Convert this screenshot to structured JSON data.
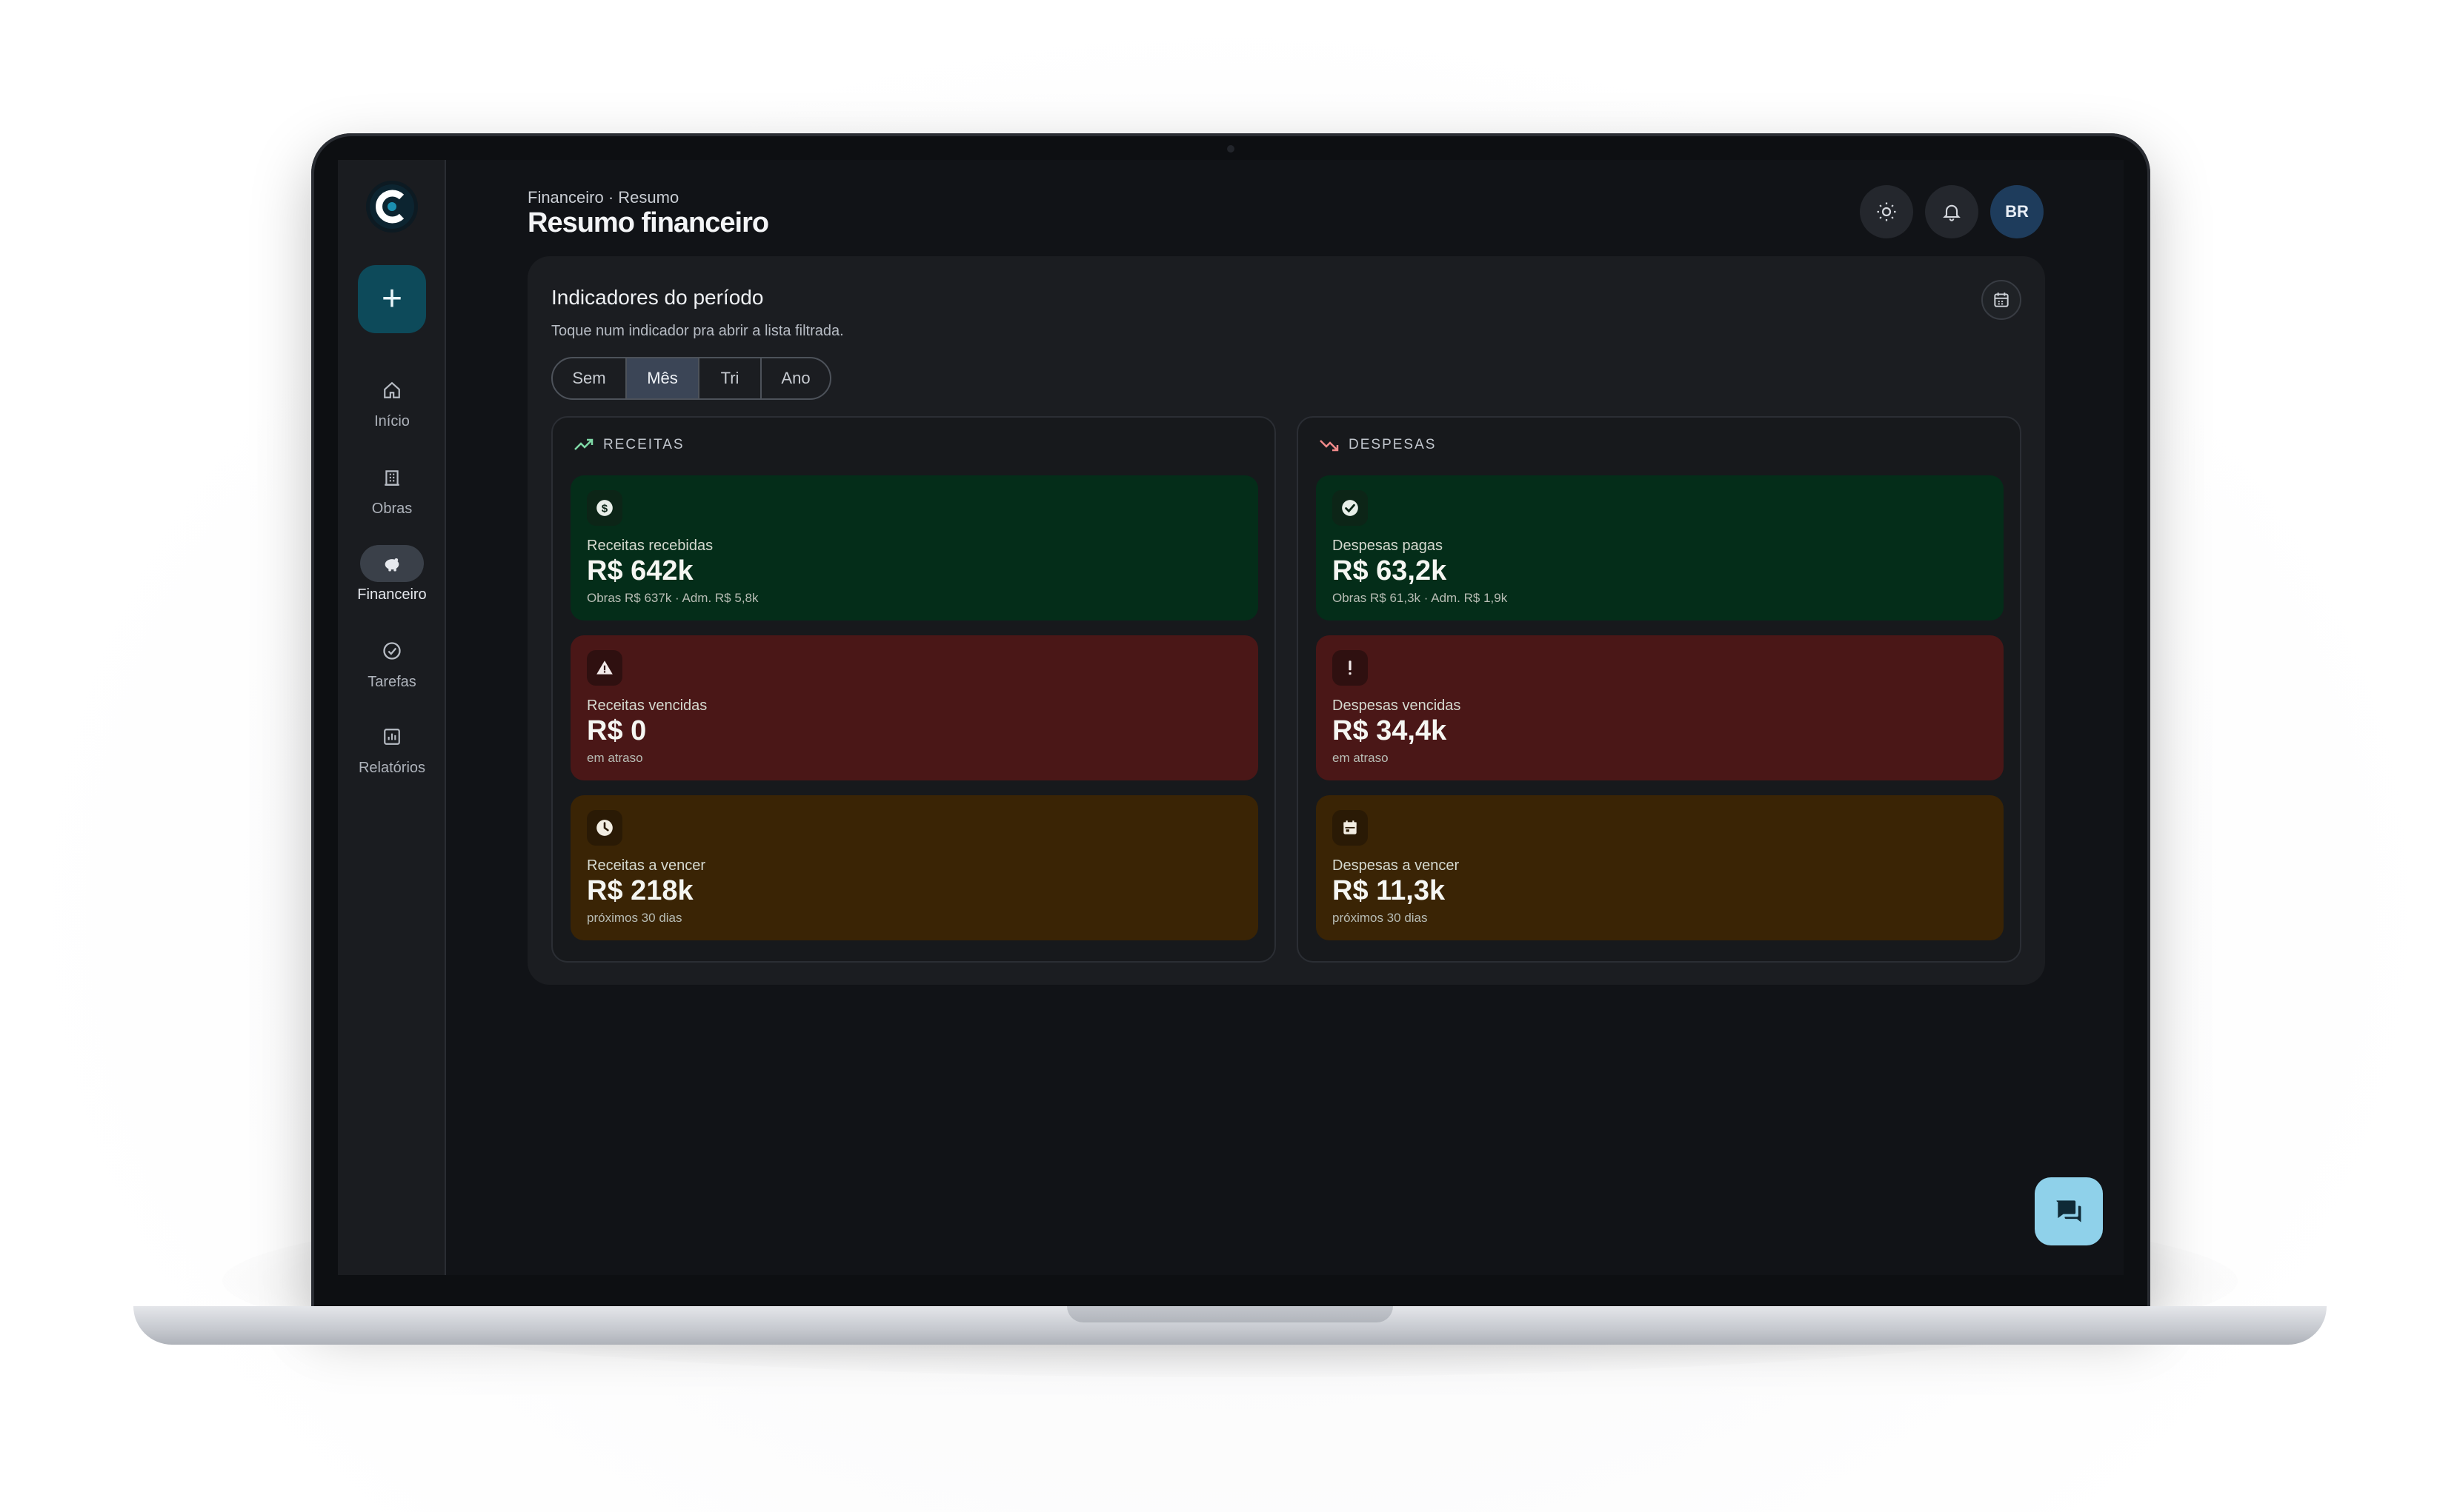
{
  "header": {
    "breadcrumb": "Financeiro · Resumo",
    "title": "Resumo financeiro",
    "avatar_initials": "BR"
  },
  "sidebar": {
    "new_button": "+",
    "items": [
      {
        "label": "Início",
        "icon": "home-icon",
        "active": false
      },
      {
        "label": "Obras",
        "icon": "building-icon",
        "active": false
      },
      {
        "label": "Financeiro",
        "icon": "piggy-bank-icon",
        "active": true
      },
      {
        "label": "Tarefas",
        "icon": "check-circle-icon",
        "active": false
      },
      {
        "label": "Relatórios",
        "icon": "chart-icon",
        "active": false
      }
    ]
  },
  "panel": {
    "title": "Indicadores do período",
    "subtitle": "Toque num indicador pra abrir a lista filtrada.",
    "periods": [
      "Sem",
      "Mês",
      "Tri",
      "Ano"
    ],
    "selected_period": "Mês"
  },
  "receitas": {
    "heading": "RECEITAS",
    "cards": [
      {
        "label": "Receitas recebidas",
        "value": "R$ 642k",
        "note": "Obras R$ 637k · Adm. R$ 5,8k",
        "tone": "green",
        "icon": "dollar-icon"
      },
      {
        "label": "Receitas vencidas",
        "value": "R$ 0",
        "note": "em atraso",
        "tone": "red",
        "icon": "warning-icon"
      },
      {
        "label": "Receitas a vencer",
        "value": "R$ 218k",
        "note": "próximos 30 dias",
        "tone": "amber",
        "icon": "clock-icon"
      }
    ]
  },
  "despesas": {
    "heading": "DESPESAS",
    "cards": [
      {
        "label": "Despesas pagas",
        "value": "R$ 63,2k",
        "note": "Obras R$ 61,3k · Adm. R$ 1,9k",
        "tone": "green",
        "icon": "check-icon"
      },
      {
        "label": "Despesas vencidas",
        "value": "R$ 34,4k",
        "note": "em atraso",
        "tone": "red",
        "icon": "exclamation-icon"
      },
      {
        "label": "Despesas a vencer",
        "value": "R$ 11,3k",
        "note": "próximos 30 dias",
        "tone": "amber",
        "icon": "calendar-icon"
      }
    ]
  },
  "colors": {
    "accent": "#0d4a5a",
    "green_card": "#042d19",
    "red_card": "#4a1717",
    "amber_card": "#3a2405",
    "chat_button": "#8fd1ea"
  }
}
